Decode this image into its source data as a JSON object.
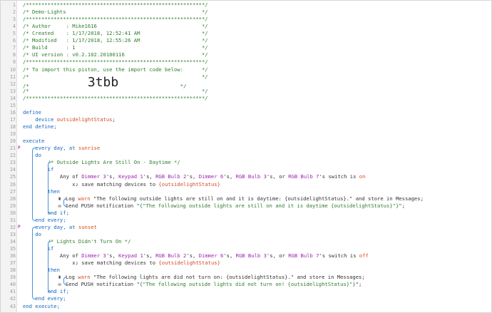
{
  "lines": [
    {
      "n": "1",
      "t": "/**********************************************************/"
    },
    {
      "n": "2",
      "t": "/* Demo-Lights                                            */"
    },
    {
      "n": "3",
      "t": "/**********************************************************/"
    },
    {
      "n": "4",
      "t": "/* Author     : Mike1616                                  */"
    },
    {
      "n": "5",
      "t": "/* Created    : 1/17/2018, 12:52:41 AM                    */"
    },
    {
      "n": "6",
      "t": "/* Modified   : 1/17/2018, 12:55:26 AM                    */"
    },
    {
      "n": "7",
      "t": "/* Build      : 1                                         */"
    },
    {
      "n": "8",
      "t": "/* UI version : v0.2.102.20180116                         */"
    },
    {
      "n": "9",
      "t": "/**********************************************************/"
    },
    {
      "n": "10",
      "t": "/* To import this piston, use the import code below:      */"
    },
    {
      "n": "11",
      "t": "/*                                                        */"
    },
    {
      "n": "12",
      "t": "/*                   "
    },
    {
      "n": "13",
      "t": "/*                                                        */"
    },
    {
      "n": "14",
      "t": "/**********************************************************/"
    },
    {
      "n": "15",
      "t": ""
    },
    {
      "n": "16",
      "t": "define"
    },
    {
      "n": "17",
      "t": "    device "
    },
    {
      "n": "18",
      "t": "end define;"
    },
    {
      "n": "19",
      "t": ""
    },
    {
      "n": "20",
      "t": "execute"
    },
    {
      "n": "21",
      "t": "    every day, at "
    },
    {
      "n": "22",
      "t": "    do"
    },
    {
      "n": "23",
      "t": "        /* Outside Lights Are Still On - Daytime */"
    },
    {
      "n": "24",
      "t": "        if"
    },
    {
      "n": "25",
      "t": ""
    },
    {
      "n": "26",
      "t": ""
    },
    {
      "n": "27",
      "t": "        then"
    },
    {
      "n": "28",
      "t": ""
    },
    {
      "n": "29",
      "t": ""
    },
    {
      "n": "30",
      "t": "        end if;"
    },
    {
      "n": "31",
      "t": "    end every;"
    },
    {
      "n": "32",
      "t": "    every day, at "
    },
    {
      "n": "33",
      "t": "    do"
    },
    {
      "n": "34",
      "t": "        /* Lights Didn't Turn On */"
    },
    {
      "n": "35",
      "t": "        if"
    },
    {
      "n": "36",
      "t": ""
    },
    {
      "n": "37",
      "t": ""
    },
    {
      "n": "38",
      "t": "        then"
    },
    {
      "n": "39",
      "t": ""
    },
    {
      "n": "40",
      "t": ""
    },
    {
      "n": "41",
      "t": "        end if;"
    },
    {
      "n": "42",
      "t": "    end every;"
    },
    {
      "n": "43",
      "t": "end execute;"
    }
  ],
  "import_code": "3tbb",
  "line12_suffix": "                    */",
  "variable_name": "outsidelightStatus",
  "sunrise": "sunrise",
  "sunset": "sunset",
  "cond1": {
    "prefix": "Any of ",
    "devices": [
      "Dimmer 3",
      "Keypad 1",
      "RGB Bulb 2",
      "Dimmer 6",
      "RGB Bulb 3",
      "RGB Bulb 7"
    ],
    "suffix": "'s switch is ",
    "value": "on"
  },
  "cond2": {
    "prefix": "Any of ",
    "devices": [
      "Dimmer 3",
      "Keypad 1",
      "RGB Bulb 2",
      "Dimmer 6",
      "RGB Bulb 3",
      "RGB Bulb 7"
    ],
    "suffix": "'s switch is ",
    "value": "off"
  },
  "save_text": "save matching devices to ",
  "save_var": "{outsidelightStatus}",
  "log1_pre": "Log ",
  "log1_level": "warn",
  "log1_msg": " \"The following outside lights are still on and it is daytime: {outsidelightStatus}.\" and store in Messages;",
  "push1_pre": "Send PUSH notification \"",
  "push1_msg": "{\"The following outside lights are still on and it is daytime {outsidelightStatus}\"}",
  "push1_post": "\";",
  "log2_pre": "Log ",
  "log2_level": "warn",
  "log2_msg": " \"The following lights are did not turn on: {outsidelightStatus}.\" and store in Messages;",
  "push2_pre": "Send PUSH notification \"",
  "push2_msg": "{\"The following outside lights did not turn on! {outsidelightStatus}\"}",
  "push2_post": "\";",
  "marker": "P"
}
